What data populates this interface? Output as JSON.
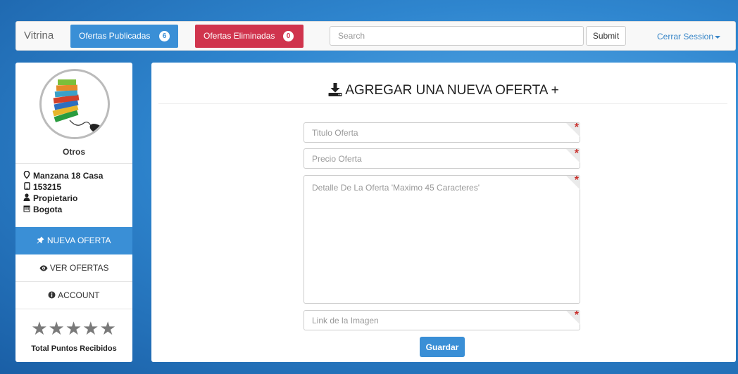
{
  "navbar": {
    "brand": "Vitrina",
    "published": {
      "label": "Ofertas Publicadas",
      "count": "6"
    },
    "deleted": {
      "label": "Ofertas Eliminadas",
      "count": "0"
    },
    "search_placeholder": "Search",
    "submit_label": "Submit",
    "session_label": "Cerrar Session"
  },
  "sidebar": {
    "username": "Otros",
    "info": [
      {
        "icon": "map-marker-icon",
        "text": "Manzana 18 Casa"
      },
      {
        "icon": "phone-icon",
        "text": "153215"
      },
      {
        "icon": "user-icon",
        "text": "Propietario"
      },
      {
        "icon": "calendar-icon",
        "text": "Bogota"
      }
    ],
    "menu": [
      {
        "icon": "pushpin-icon",
        "label": "NUEVA OFERTA"
      },
      {
        "icon": "eye-icon",
        "label": "VER OFERTAS"
      },
      {
        "icon": "info-icon",
        "label": "ACCOUNT"
      }
    ],
    "rating_stars": 5,
    "points_label": "Total Puntos Recibidos"
  },
  "form": {
    "title": "AGREGAR UNA NUEVA OFERTA +",
    "title_placeholder": "Titulo Oferta",
    "price_placeholder": "Precio Oferta",
    "detail_placeholder": "Detalle De La Oferta 'Maximo 45 Caracteres'",
    "image_placeholder": "Link de la Imagen",
    "save_label": "Guardar"
  },
  "colors": {
    "primary": "#3a8fd6",
    "danger": "#d0344d",
    "required": "#c9302c"
  }
}
